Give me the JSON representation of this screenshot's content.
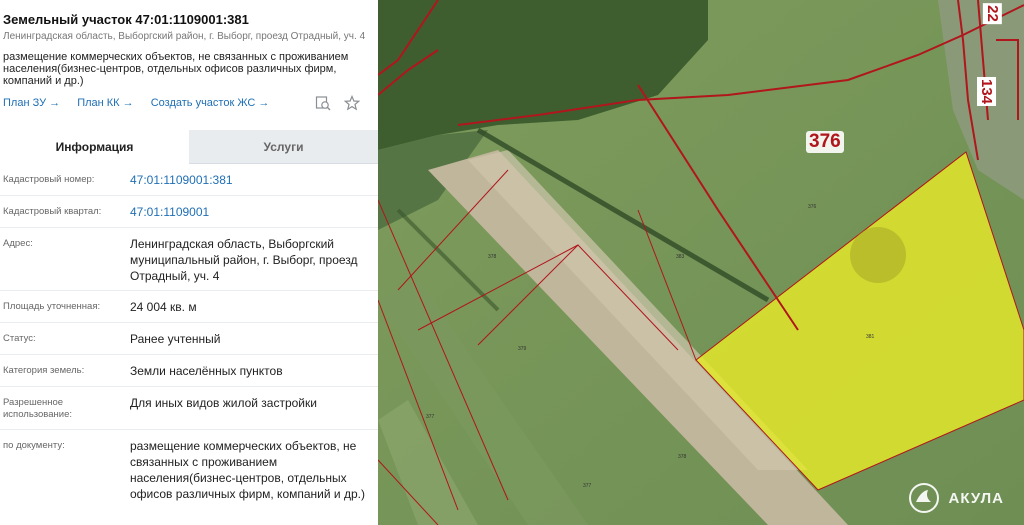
{
  "parcel": {
    "title": "Земельный участок 47:01:1109001:381",
    "address_short": "Ленинградская область, Выборгский район, г. Выборг, проезд Отрадный, уч. 4",
    "purpose": "размещение коммерческих объектов, не связанных с проживанием населения(бизнес-центров, отдельных офисов различных фирм, компаний и др.)"
  },
  "links": {
    "plan_zu": "План ЗУ →",
    "plan_kk": "План КК →",
    "create": "Создать участок ЖС →"
  },
  "icons": {
    "search_map": "map-search-icon",
    "favorite": "star-icon"
  },
  "tabs": {
    "info": "Информация",
    "services": "Услуги"
  },
  "rows": [
    {
      "label": "Кадастровый номер:",
      "value": "47:01:1109001:381"
    },
    {
      "label": "Кадастровый квартал:",
      "value": "47:01:1109001"
    },
    {
      "label": "Адрес:",
      "value": "Ленинградская область, Выборгский муниципальный район, г. Выборг, проезд Отрадный, уч. 4"
    },
    {
      "label": "Площадь уточненная:",
      "value": "24 004 кв. м"
    },
    {
      "label": "Статус:",
      "value": "Ранее учтенный"
    },
    {
      "label": "Категория земель:",
      "value": "Земли населённых пунктов"
    },
    {
      "label": "Разрешенное использование:",
      "value": "Для иных видов жилой застройки"
    },
    {
      "label": "по документу:",
      "value": "размещение коммерческих объектов, не связанных с проживанием населения(бизнес-центров, отдельных офисов различных фирм, компаний и др.)"
    }
  ],
  "map": {
    "labels": {
      "l376": "376",
      "l134": "134",
      "l22": "22"
    },
    "parcel_fill": "#e6ea2a",
    "border_color": "#b0161c"
  },
  "watermark": {
    "text": "АКУЛА"
  }
}
